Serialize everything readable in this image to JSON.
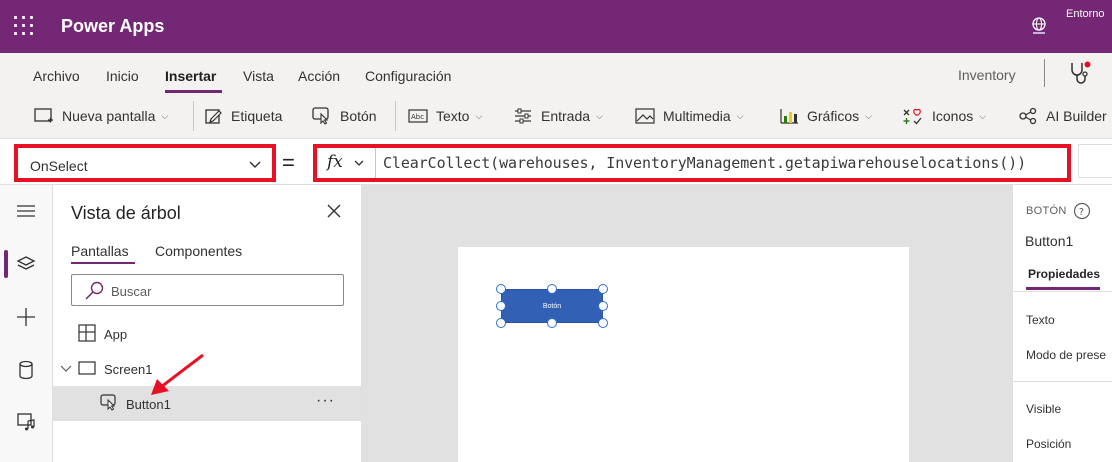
{
  "header": {
    "app_title": "Power Apps",
    "environment_label": "Entorno"
  },
  "menu": {
    "items": [
      "Archivo",
      "Inicio",
      "Insertar",
      "Vista",
      "Acción",
      "Configuración"
    ],
    "active": "Insertar",
    "app_name": "Inventory"
  },
  "ribbon": {
    "new_screen": "Nueva pantalla",
    "label": "Etiqueta",
    "button": "Botón",
    "text": "Texto",
    "input": "Entrada",
    "media": "Multimedia",
    "charts": "Gráficos",
    "icons": "Iconos",
    "ai_builder": "AI Builder"
  },
  "formula_bar": {
    "property": "OnSelect",
    "equals": "=",
    "fx": "fx",
    "formula": "ClearCollect(warehouses, InventoryManagement.getapiwarehouselocations())"
  },
  "tree_view": {
    "title": "Vista de árbol",
    "tabs": [
      "Pantallas",
      "Componentes"
    ],
    "active_tab": "Pantallas",
    "search_placeholder": "Buscar",
    "nodes": {
      "app": "App",
      "screen": "Screen1",
      "button": "Button1"
    },
    "more": "···"
  },
  "canvas": {
    "button_text": "Botón"
  },
  "properties_panel": {
    "control_type": "BOTÓN",
    "control_name": "Button1",
    "tab": "Propiedades",
    "props": [
      "Texto",
      "Modo de prese",
      "Visible",
      "Posición"
    ]
  },
  "colors": {
    "brand": "#742774",
    "highlight_border": "#e81123",
    "button_fill": "#3160b5",
    "arrow": "#e81123"
  }
}
